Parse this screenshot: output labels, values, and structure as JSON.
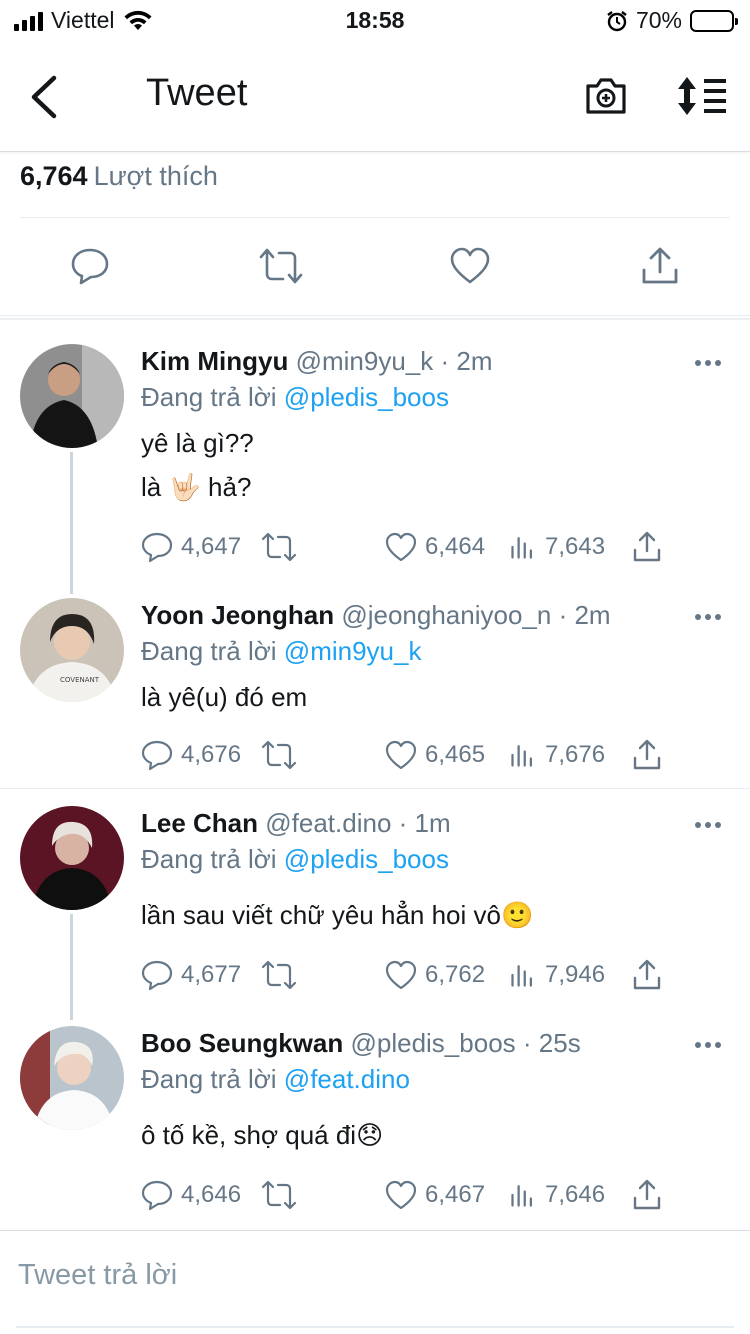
{
  "status_bar": {
    "carrier": "Viettel",
    "time": "18:58",
    "battery": "70%",
    "battery_level": 0.7
  },
  "nav": {
    "title": "Tweet",
    "icons": [
      "back-chevron-icon",
      "camera-plus-icon",
      "sort-icon"
    ]
  },
  "likes": {
    "count": "6,764",
    "label": "Lượt thích"
  },
  "actions": [
    "reply-icon",
    "retweet-icon",
    "like-icon",
    "share-icon"
  ],
  "tweets": [
    {
      "name": "Kim Mingyu",
      "handle": "@min9yu_k",
      "time": "· 2m",
      "reply_prefix": "Đang trả lời",
      "reply_to": "@pledis_boos",
      "lines": [
        "yê là gì??",
        "là 🤟🏻  hả?"
      ],
      "replies": "4,647",
      "likes": "6,464",
      "views": "7,643",
      "avatar_color": "#3a3a3a"
    },
    {
      "name": "Yoon Jeonghan",
      "handle": "@jeonghaniyoo_n",
      "time": "· 2m",
      "reply_prefix": "Đang trả lời",
      "reply_to": "@min9yu_k",
      "lines": [
        "là yê(u) đó em"
      ],
      "replies": "4,676",
      "likes": "6,465",
      "views": "7,676",
      "avatar_color": "#cfc7bd"
    },
    {
      "name": "Lee Chan",
      "handle": "@feat.dino",
      "time": "· 1m",
      "reply_prefix": "Đang trả lời",
      "reply_to": "@pledis_boos",
      "lines": [
        "lần sau viết chữ yêu hẳn hoi vô🙂"
      ],
      "replies": "4,677",
      "likes": "6,762",
      "views": "7,946",
      "avatar_color": "#6b1a2e"
    },
    {
      "name": "Boo Seungkwan",
      "handle": "@pledis_boos",
      "time": "· 25s",
      "reply_prefix": "Đang trả lời",
      "reply_to": "@feat.dino",
      "lines": [
        "ô tố kề, shợ quá đi😞"
      ],
      "replies": "4,646",
      "likes": "6,467",
      "views": "7,646",
      "avatar_color": "#d9d4cf"
    }
  ],
  "composer": {
    "placeholder": "Tweet trả lời"
  },
  "colors": {
    "link": "#1da1f2",
    "secondary": "#657786",
    "text": "#14171a",
    "divider": "#e6ecf0"
  }
}
